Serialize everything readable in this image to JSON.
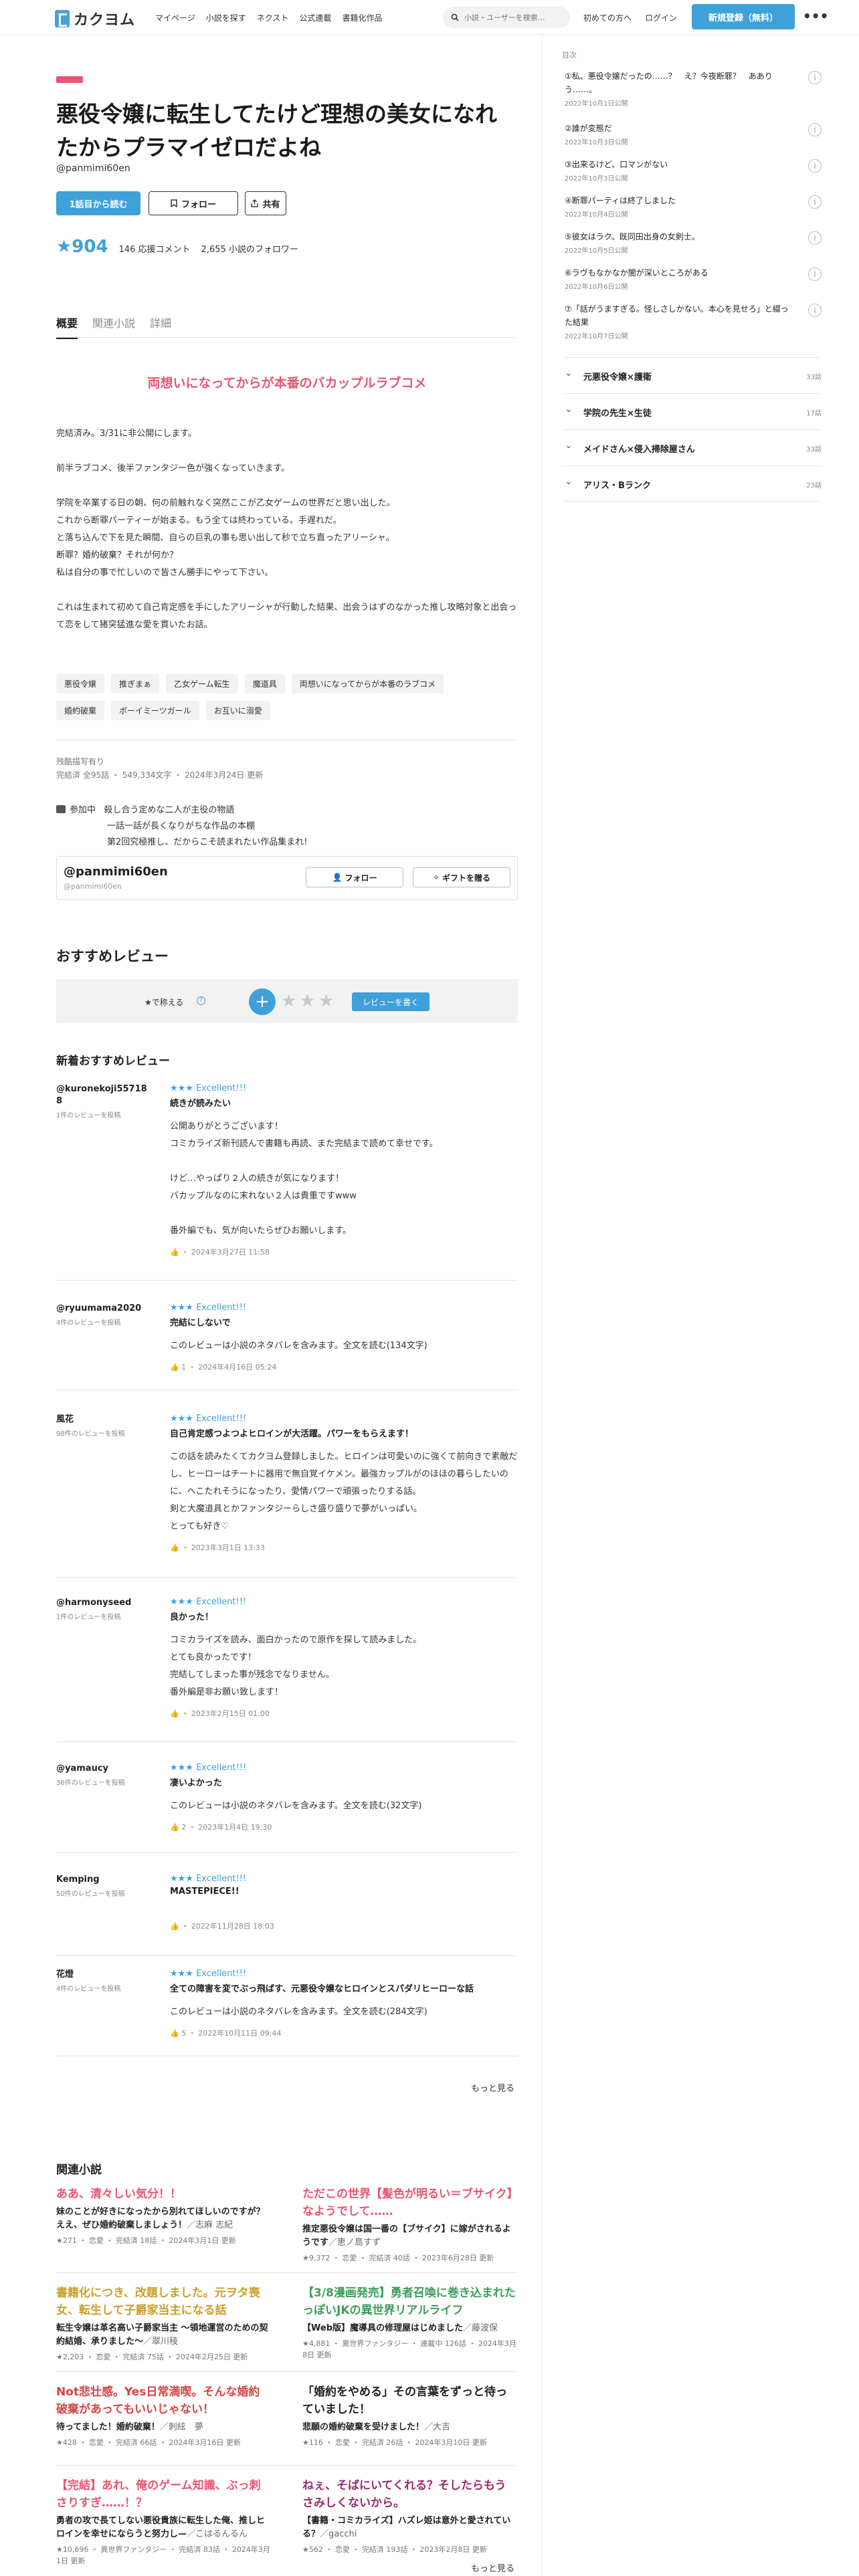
{
  "header": {
    "logo": "カクヨム",
    "nav": [
      "マイページ",
      "小説を探す",
      "ネクスト",
      "公式連載",
      "書籍化作品"
    ],
    "search_placeholder": "小説・ユーザーを検索…",
    "first_time": "初めての方へ",
    "login": "ログイン",
    "signup": "新規登録（無料）"
  },
  "work": {
    "title": "悪役令嬢に転生してたけど理想の美女になれたからプラマイゼロだよね",
    "author": "@panmimi60en",
    "read_btn": "1話目から読む",
    "follow_btn": "フォロー",
    "share_btn": "共有",
    "stars": "★904",
    "comments": "146 応援コメント",
    "followers": "2,655 小説のフォロワー"
  },
  "tabs": [
    "概要",
    "関連小説",
    "詳細"
  ],
  "catchcopy": "両想いになってからが本番のバカップルラブコメ",
  "intro": "完結済み。3/31に非公開にします。\n\n前半ラブコメ、後半ファンタジー色が強くなっていきます。\n\n学院を卒業する日の朝、何の前触れなく突然ここが乙女ゲームの世界だと思い出した。\nこれから断罪パーティーが始まる。もう全ては終わっている。手遅れだ。\nと落ち込んで下を見た瞬間、自らの巨乳の事も思い出して秒で立ち直ったアリーシャ。\n断罪？婚約破棄？それが何か？\n私は自分の事で忙しいので皆さん勝手にやって下さい。\n\nこれは生まれて初めて自己肯定感を手にしたアリーシャが行動した結果、出会うはずのなかった推し攻略対象と出会って恋をして猪突猛進な愛を貫いたお話。",
  "tags_row1": [
    "悪役令嬢",
    "推ぎまぁ",
    "乙女ゲーム転生",
    "魔道具",
    "両想いになってからが本番のラブコメ"
  ],
  "tags_row2": [
    "婚約破棄",
    "ボーイミーツガール",
    "お互いに溺愛"
  ],
  "status_label": "残酷描写有り",
  "status_line": "完結済 全95話 ・ 549,334文字 ・ 2024年3月24日 更新",
  "event": {
    "label": "参加中",
    "lines": [
      "殺し合う定めな二人が主役の物語",
      "一話一話が長くなりがちな作品の本棚",
      "第2回究極推し、だからこそ読まれたい作品集まれ!"
    ]
  },
  "author_card": {
    "name": "@panmimi60en",
    "id": "@panmimi60en",
    "follow": "フォロー",
    "gift": "ギフトを贈る"
  },
  "reviews_section": {
    "title": "おすすめレビュー",
    "rate_label": "★で称える",
    "write_btn": "レビューを書く",
    "new_title": "新着おすすめレビュー",
    "more": "もっと見る"
  },
  "reviews": [
    {
      "user": "@kuronekoji55718 8",
      "count": "1件のレビューを投稿",
      "rating": "★★★ Excellent!!!",
      "title": "続きが読みたい",
      "text": "公開ありがとうございます！\nコミカライズ新刊読んで書籍も再読、また完結まで読めて幸せです。\n\nけど…やっぱり２人の続きが気になります！\nバカップルなのに末れない２人は貴重ですwww\n\n番外編でも、気が向いたらぜひお願いします。",
      "meta": "・ 2024年3月27日 11:58"
    },
    {
      "user": "@ryuumama2020",
      "count": "4件のレビューを投稿",
      "rating": "★★★ Excellent!!!",
      "title": "完結にしないで",
      "text": "このレビューは小説のネタバレを含みます。全文を読む(134文字)",
      "meta": "1 ・ 2024年4月16日 05:24"
    },
    {
      "user": "風花",
      "count": "98件のレビューを投稿",
      "rating": "★★★ Excellent!!!",
      "title": "自己肯定感つよつよヒロインが大活躍。パワーをもらえます！",
      "text": "この話を読みたくてカクヨム登録しました。ヒロインは可愛いのに強くて前向きで素敵だし、ヒーローはチートに器用で無自覚イケメン。最強カップルがのほほの暮らしたいのに、へこたれそうになったり、愛情パワーで頑張ったりする話。\n剣と大魔道具とかファンタジーらしさ盛り盛りで夢がいっぱい。\nとっても好き♡",
      "meta": "・ 2023年3月1日 13:33"
    },
    {
      "user": "@harmonyseed",
      "count": "1件のレビューを投稿",
      "rating": "★★★ Excellent!!!",
      "title": "良かった！",
      "text": "コミカライズを読み、面白かったので原作を探して読みました。\nとても良かったです！\n完結してしまった事が残念でなりません。\n番外編是非お願い致します！",
      "meta": "・ 2023年2月15日 01:00"
    },
    {
      "user": "@yamaucy",
      "count": "36件のレビューを投稿",
      "rating": "★★★ Excellent!!!",
      "title": "凄いよかった",
      "text": "このレビューは小説のネタバレを含みます。全文を読む(32文字)",
      "meta": "2 ・ 2023年1月4日 19:30"
    },
    {
      "user": "Kemping",
      "count": "50件のレビューを投稿",
      "rating": "★★★ Excellent!!!",
      "title": "MASTEPIECE!!",
      "text": "",
      "meta": "・ 2022年11月28日 18:03"
    },
    {
      "user": "花燈",
      "count": "4件のレビューを投稿",
      "rating": "★★★ Excellent!!!",
      "title": "全ての障害を変でぶっ飛ばす、元悪役令嬢なヒロインとスパダリヒーローな話",
      "text": "このレビューは小説のネタバレを含みます。全文を読む(284文字)",
      "meta": "5 ・ 2022年10月11日 09:44"
    }
  ],
  "related": {
    "title": "関連小説",
    "more": "もっと見る",
    "items": [
      {
        "catch": "ああ、清々しい気分！！",
        "catch_color": "#e85670",
        "title": "妹のことが好きになったから別れてほしいのですが？　ええ、ぜひ婚約破棄しましょう！",
        "author": "／志麻 志紀",
        "meta": "★271 ・ 恋愛 ・ 完結済 18話 ・ 2024年3月1日 更新"
      },
      {
        "catch": "ただこの世界【髪色が明るい＝ブサイク】なようでして……",
        "catch_color": "#e85670",
        "title": "推定悪役令嬢は国一番の【ブサイク】に嫁がされるようです",
        "author": "／恵ノ島すず",
        "meta": "★9,372 ・ 恋愛 ・ 完結済 40話 ・ 2023年6月28日 更新"
      },
      {
        "catch": "書籍化につき、改題しました。元ヲタ喪女、転生して子爵家当主になる話",
        "catch_color": "#c9a02b",
        "title": "転生令嬢は革名高い子爵家当主 〜領地運営のための契約結婚、承りました〜",
        "author": "／翠川稜",
        "meta": "★2,203 ・ 恋愛 ・ 完結済 75話 ・ 2024年2月25日 更新"
      },
      {
        "catch": "【3/8漫画発売】勇者召喚に巻き込まれたっぽいJKの異世界リアルライフ",
        "catch_color": "#3c9f5a",
        "title": "【Web版】魔導具の修理屋はじめました",
        "author": "／藤波保",
        "meta": "★4,881 ・ 異世界ファンタジー ・ 連載中 126話 ・ 2024年3月8日 更新"
      },
      {
        "catch": "Not悲壮感。Yes日常満喫。そんな婚約破棄があってもいいじゃない！",
        "catch_color": "#d94343",
        "title": "待ってました！婚約破棄！",
        "author": "／刺絃　夢",
        "meta": "★428 ・ 恋愛 ・ 完結済 66話 ・ 2024年3月16日 更新"
      },
      {
        "catch": "「婚約をやめる」その言葉をずっと待っていました！",
        "catch_color": "#222222",
        "title": "悲願の婚約破棄を受けました！",
        "author": "／大吉",
        "meta": "★116 ・ 恋愛 ・ 完結済 26話 ・ 2024年3月10日 更新"
      },
      {
        "catch": "【完結】あれ、俺のゲーム知識、ぶっ刺さりすぎ……！？",
        "catch_color": "#e85670",
        "title": "勇者の攻で長てしない悪役貴族に転生した俺、推しヒロインを幸せにならうと努力し—",
        "author": "／こはるんるん",
        "meta": "★10,696 ・ 異世界ファンタジー ・ 完結済 83話 ・ 2024年3月1日 更新"
      },
      {
        "catch": "ねぇ、そばにいてくれる？そしたらもうさみしくないから。",
        "catch_color": "#9a2a6e",
        "title": "【書籍・コミカライズ】ハズレ姫は意外と愛されている？",
        "author": "／gacchi",
        "meta": "★562 ・ 恋愛 ・ 完結済 193話 ・ 2023年2月8日 更新"
      }
    ]
  },
  "toc": {
    "label": "目次",
    "items": [
      {
        "title": "①私、悪役令嬢だったの……？　え？今夜断罪？　あありう……。",
        "date": "2022年10月1日公開"
      },
      {
        "title": "②誰が変態だ",
        "date": "2022年10月3日公開"
      },
      {
        "title": "③出来るけど、口マンがない",
        "date": "2022年10月3日公開"
      },
      {
        "title": "④断罪パーティは終了しました",
        "date": "2022年10月4日公開"
      },
      {
        "title": "⑤彼女はラク。既同田出身の女剣士。",
        "date": "2022年10月5日公開"
      },
      {
        "title": "⑥ラヴもなかなか闇が深いところがある",
        "date": "2022年10月6日公開"
      },
      {
        "title": "⑦「話がうますぎる。怪しさしかない。本心を見せろ」と綴った結果",
        "date": "2022年10月7日公開"
      }
    ],
    "chapters": [
      {
        "title": "元悪役令嬢×護衛",
        "count": "33話"
      },
      {
        "title": "学院の先生×生徒",
        "count": "17話"
      },
      {
        "title": "メイドさん×侵入掃除屋さん",
        "count": "33話"
      },
      {
        "title": "アリス・Bランク",
        "count": "23話"
      }
    ]
  }
}
